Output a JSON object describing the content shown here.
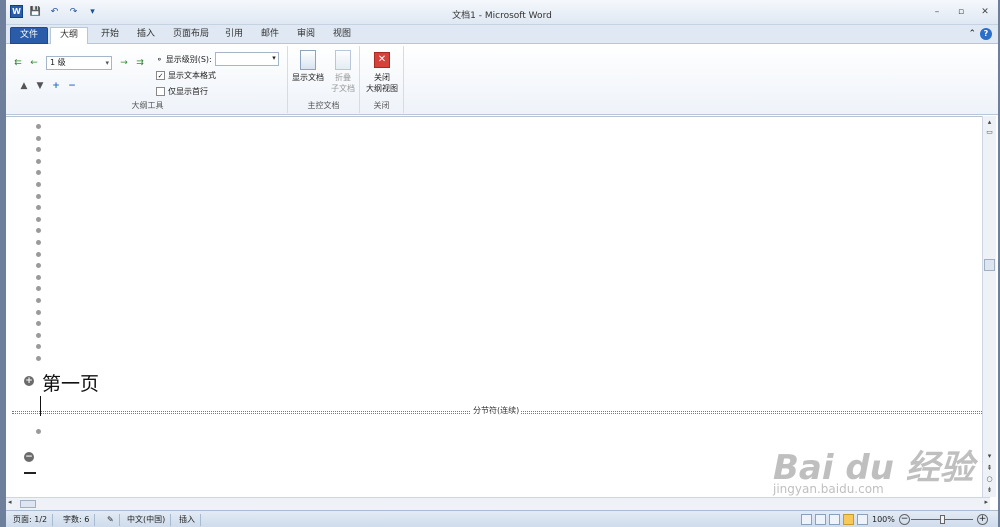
{
  "window": {
    "title": "文档1 - Microsoft Word"
  },
  "qat": {
    "logo": "W",
    "save": "💾",
    "undo": "↶",
    "redo": "↷",
    "customize": "▾"
  },
  "window_controls": {
    "minimize": "–",
    "restore": "▫",
    "close": "✕"
  },
  "tabs": [
    "文件",
    "大纲",
    "开始",
    "插入",
    "页面布局",
    "引用",
    "邮件",
    "审阅",
    "视图"
  ],
  "active_tab": "大纲",
  "tab_right": {
    "collapse": "⌃",
    "help": "?"
  },
  "ribbon": {
    "outline_tools": {
      "level_value": "1 级",
      "show_level_label": "显示级别(S):",
      "show_level_value": "",
      "show_text_formatting": "显示文本格式",
      "show_first_line_only": "仅显示首行",
      "group_label": "大纲工具",
      "promote_to_heading": "⇇",
      "promote": "←",
      "demote": "→",
      "demote_to_body": "⇉",
      "move_up": "▲",
      "move_down": "▼",
      "expand": "+",
      "collapse": "−"
    },
    "master_doc": {
      "show_document": "显示文档",
      "collapse_sub_1": "折叠",
      "collapse_sub_2": "子文档",
      "group_label": "主控文档"
    },
    "close": {
      "close_1": "关闭",
      "close_2": "大纲视图",
      "group_label": "关闭"
    }
  },
  "document": {
    "heading": "第一页",
    "section_break": "分节符(连续)"
  },
  "status_bar": {
    "page": "页面: 1/2",
    "words": "字数: 6",
    "language": "中文(中国)",
    "mode": "插入",
    "zoom": "100%",
    "zoom_level": 1.0
  },
  "watermark": {
    "line1": "Bai du 经验",
    "line2": "jingyan.baidu.com"
  }
}
